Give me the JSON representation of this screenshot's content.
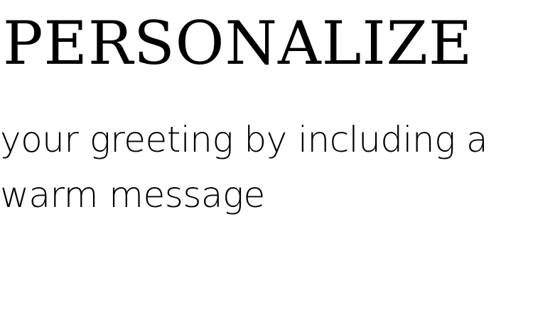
{
  "headline": "PERSONALIZE",
  "body_text": "your greeting by including a warm message",
  "colors": {
    "background": "#ffffff",
    "text": "#000000"
  }
}
